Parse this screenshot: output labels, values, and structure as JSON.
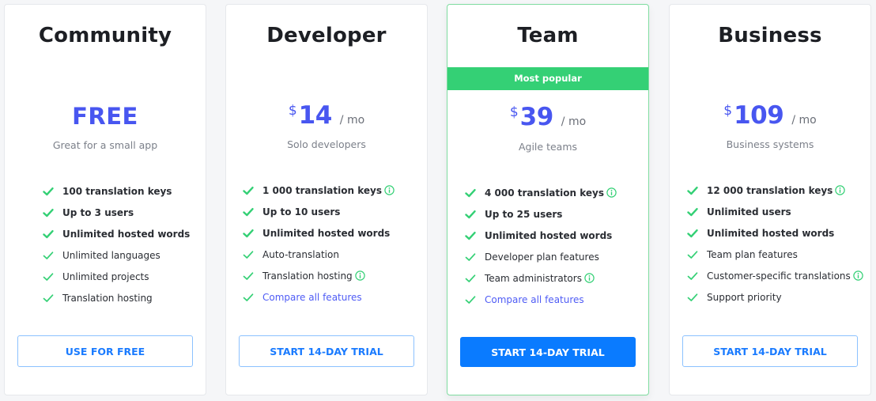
{
  "colors": {
    "price": "#4856f0",
    "check": "#34d075",
    "popular_banner": "#34d075",
    "cta_primary": "#0a7bff",
    "cta_outline_text": "#1a7bff",
    "link": "#4f5cf5"
  },
  "plans": [
    {
      "title": "Community",
      "price_label": "FREE",
      "subtitle": "Great for a small app",
      "features": [
        {
          "text": "100 translation keys",
          "bold": true,
          "info": false
        },
        {
          "text": "Up to 3 users",
          "bold": true,
          "info": false
        },
        {
          "text": "Unlimited hosted words",
          "bold": true,
          "info": false
        },
        {
          "text": "Unlimited languages",
          "bold": false,
          "info": false
        },
        {
          "text": "Unlimited projects",
          "bold": false,
          "info": false
        },
        {
          "text": "Translation hosting",
          "bold": false,
          "info": false
        }
      ],
      "cta": "USE FOR FREE"
    },
    {
      "title": "Developer",
      "currency": "$",
      "amount": "14",
      "period": "/ mo",
      "subtitle": "Solo developers",
      "features": [
        {
          "text": "1 000 translation keys",
          "bold": true,
          "info": true
        },
        {
          "text": "Up to 10 users",
          "bold": true,
          "info": false
        },
        {
          "text": "Unlimited hosted words",
          "bold": true,
          "info": false
        },
        {
          "text": "Auto-translation",
          "bold": false,
          "info": false
        },
        {
          "text": "Translation hosting",
          "bold": false,
          "info": true
        },
        {
          "text": "Compare all features",
          "bold": false,
          "info": false,
          "link": true
        }
      ],
      "cta": "START 14-DAY TRIAL"
    },
    {
      "title": "Team",
      "badge": "Most popular",
      "currency": "$",
      "amount": "39",
      "period": "/ mo",
      "subtitle": "Agile teams",
      "features": [
        {
          "text": "4 000 translation keys",
          "bold": true,
          "info": true
        },
        {
          "text": "Up to 25 users",
          "bold": true,
          "info": false
        },
        {
          "text": "Unlimited hosted words",
          "bold": true,
          "info": false
        },
        {
          "text": "Developer plan features",
          "bold": false,
          "info": false
        },
        {
          "text": "Team administrators",
          "bold": false,
          "info": true
        },
        {
          "text": "Compare all features",
          "bold": false,
          "info": false,
          "link": true
        }
      ],
      "cta": "START 14-DAY TRIAL"
    },
    {
      "title": "Business",
      "currency": "$",
      "amount": "109",
      "period": "/ mo",
      "subtitle": "Business systems",
      "features": [
        {
          "text": "12 000 translation keys",
          "bold": true,
          "info": true
        },
        {
          "text": "Unlimited users",
          "bold": true,
          "info": false
        },
        {
          "text": "Unlimited hosted words",
          "bold": true,
          "info": false
        },
        {
          "text": "Team plan features",
          "bold": false,
          "info": false
        },
        {
          "text": "Customer-specific translations",
          "bold": false,
          "info": true
        },
        {
          "text": "Support priority",
          "bold": false,
          "info": false
        }
      ],
      "cta": "START 14-DAY TRIAL"
    }
  ]
}
